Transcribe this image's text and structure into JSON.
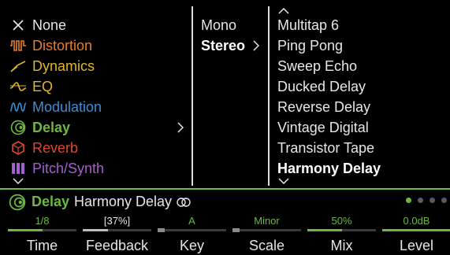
{
  "categories": [
    {
      "label": "None",
      "icon": "close-icon",
      "color": "#e6e6e6"
    },
    {
      "label": "Distortion",
      "icon": "distortion-waveform-icon",
      "color": "#e87d2c"
    },
    {
      "label": "Dynamics",
      "icon": "dynamics-icon",
      "color": "#e0b52b"
    },
    {
      "label": "EQ",
      "icon": "eq-icon",
      "color": "#e0b52b"
    },
    {
      "label": "Modulation",
      "icon": "modulation-icon",
      "color": "#3a8ed8"
    },
    {
      "label": "Delay",
      "icon": "delay-icon",
      "color": "#6cb842",
      "selected": true
    },
    {
      "label": "Reverb",
      "icon": "reverb-icon",
      "color": "#e0462c"
    },
    {
      "label": "Pitch/Synth",
      "icon": "pitch-synth-icon",
      "color": "#a45fd0"
    }
  ],
  "modes": [
    {
      "label": "Mono"
    },
    {
      "label": "Stereo",
      "selected": true
    }
  ],
  "models": [
    {
      "label": "Multitap 6"
    },
    {
      "label": "Ping Pong"
    },
    {
      "label": "Sweep Echo"
    },
    {
      "label": "Ducked Delay"
    },
    {
      "label": "Reverse Delay"
    },
    {
      "label": "Vintage Digital"
    },
    {
      "label": "Transistor Tape"
    },
    {
      "label": "Harmony Delay",
      "selected": true
    }
  ],
  "status": {
    "category": "Delay",
    "model": "Harmony Delay",
    "icon": "delay-icon",
    "link_icon": "stereo-link-icon",
    "page_count": 4,
    "current_page": 1
  },
  "params": [
    {
      "label": "Time",
      "value": "1/8",
      "level": 0.5
    },
    {
      "label": "Feedback",
      "value": "[37%]",
      "level": 0.37
    },
    {
      "label": "Key",
      "value": "A",
      "level": 0.0
    },
    {
      "label": "Scale",
      "value": "Minor",
      "level": 0.0
    },
    {
      "label": "Mix",
      "value": "50%",
      "level": 0.5
    },
    {
      "label": "Level",
      "value": "0.0dB",
      "level": 1.0
    }
  ],
  "colors": {
    "accent": "#6cb842",
    "divider": "#dcdcdc",
    "bar_track": "#3a3a3a"
  }
}
